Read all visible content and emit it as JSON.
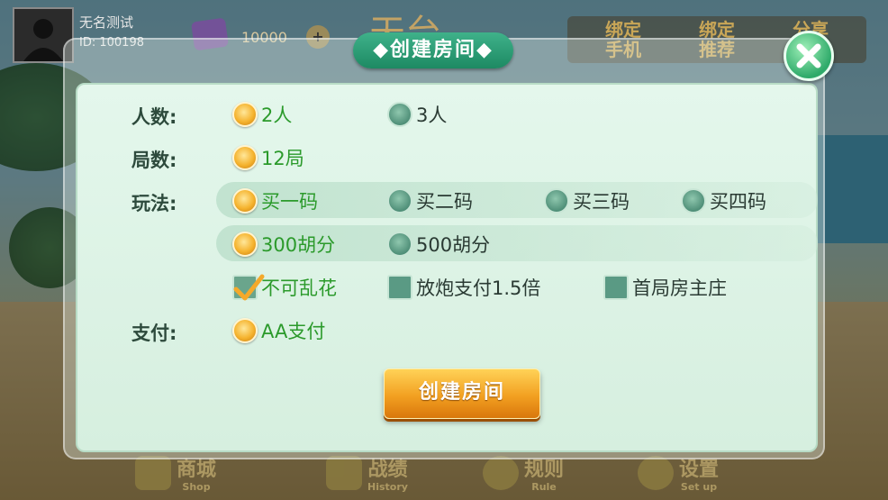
{
  "player": {
    "name": "无名测试",
    "id": "ID: 100198"
  },
  "currency": {
    "count": "10000",
    "add_label": "+"
  },
  "top_buttons": [
    {
      "label": "绑定\n手机"
    },
    {
      "label": "绑定\n推荐"
    },
    {
      "label": "分享\n签到"
    }
  ],
  "bottom_nav": [
    {
      "label": "商城",
      "sub": "Shop"
    },
    {
      "label": "战绩",
      "sub": "History"
    },
    {
      "label": "规则",
      "sub": "Rule"
    },
    {
      "label": "设置",
      "sub": "Set up"
    }
  ],
  "dialog": {
    "title": "◆创建房间◆",
    "rows": {
      "players": {
        "label": "人数:",
        "options": [
          "2人",
          "3人"
        ],
        "selected": 0
      },
      "rounds": {
        "label": "局数:",
        "options": [
          "12局"
        ],
        "selected": 0
      },
      "mode": {
        "label": "玩法:",
        "options": [
          "买一码",
          "买二码",
          "买三码",
          "买四码"
        ],
        "selected": 0
      },
      "score": {
        "options": [
          "300胡分",
          "500胡分"
        ],
        "selected": 0
      },
      "rules": {
        "options": [
          "不可乱花",
          "放炮支付1.5倍",
          "首局房主庄"
        ],
        "checked": [
          true,
          false,
          false
        ]
      },
      "payment": {
        "label": "支付:",
        "options": [
          "AA支付"
        ],
        "selected": 0
      }
    },
    "create_button": "创建房间"
  },
  "colors": {
    "accent": "#f2a021",
    "selected_text": "#2b9a2b",
    "title_bar": "#1d8a63"
  }
}
